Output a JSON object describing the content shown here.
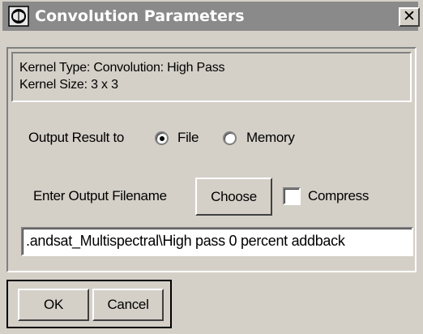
{
  "window": {
    "title": "Convolution Parameters",
    "close_glyph": "✕",
    "icon": "app-icon"
  },
  "kernel_info": {
    "type_line": "Kernel Type: Convolution: High Pass",
    "size_line": "Kernel Size: 3 x 3"
  },
  "output": {
    "label": "Output Result to",
    "options": [
      {
        "label": "File",
        "selected": true
      },
      {
        "label": "Memory",
        "selected": false
      }
    ]
  },
  "filename": {
    "label": "Enter Output Filename",
    "choose_label": "Choose",
    "compress_label": "Compress",
    "compress_checked": false,
    "value": ".andsat_Multispectral\\High pass 0 percent addback"
  },
  "buttons": {
    "ok": "OK",
    "cancel": "Cancel"
  },
  "colors": {
    "face": "#d4d0c8",
    "titlebar": "#8a8a8a",
    "title_text": "#ffffff"
  }
}
